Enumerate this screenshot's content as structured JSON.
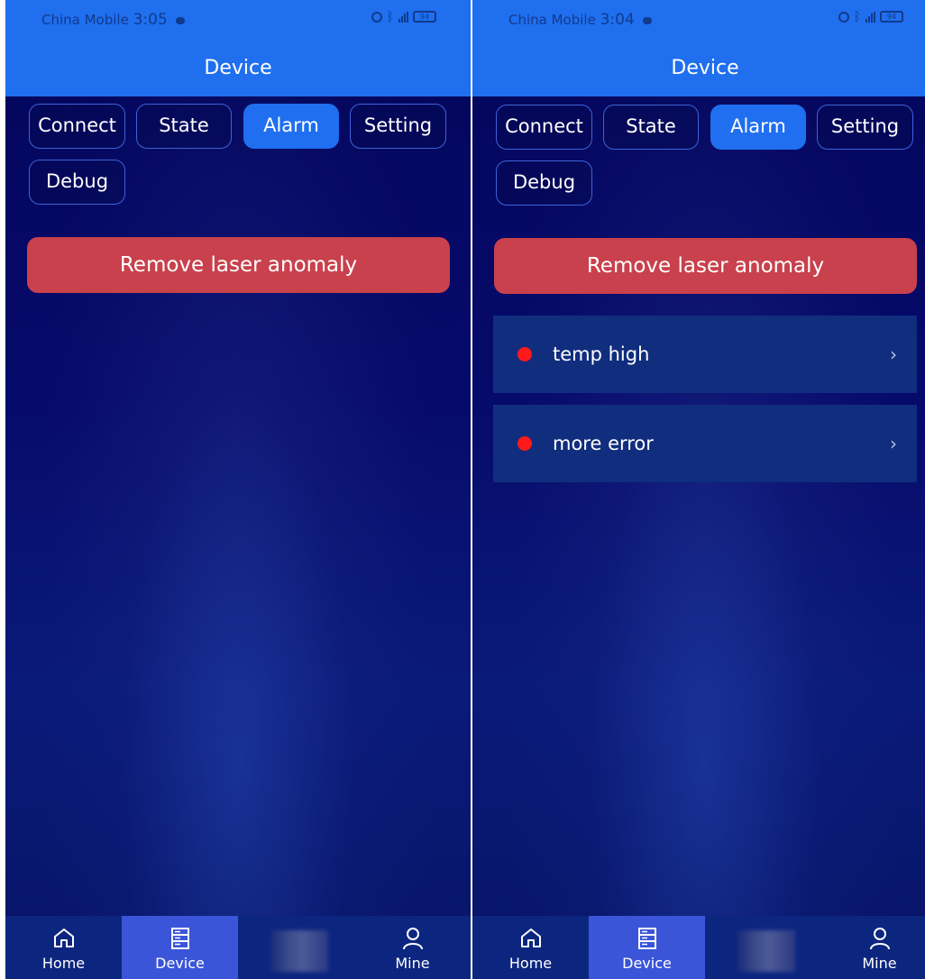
{
  "screens": [
    {
      "status": {
        "carrier": "China Mobile",
        "time": "3:05",
        "battery": "94"
      },
      "title": "Device",
      "tabs": [
        "Connect",
        "State",
        "Alarm",
        "Setting",
        "Debug"
      ],
      "active_tab": "Alarm",
      "remove_button": "Remove laser anomaly",
      "alarms": [],
      "nav": [
        "Home",
        "Device",
        "",
        "Mine"
      ],
      "active_nav": "Device"
    },
    {
      "status": {
        "carrier": "China Mobile",
        "time": "3:04",
        "battery": "94"
      },
      "title": "Device",
      "tabs": [
        "Connect",
        "State",
        "Alarm",
        "Setting",
        "Debug"
      ],
      "active_tab": "Alarm",
      "remove_button": "Remove laser anomaly",
      "alarms": [
        {
          "label": "temp high",
          "chevron": "›"
        },
        {
          "label": "more error",
          "chevron": "›"
        }
      ],
      "nav": [
        "Home",
        "Device",
        "",
        "Mine"
      ],
      "active_nav": "Device"
    }
  ],
  "colors": {
    "header": "#1f6fef",
    "active_tab": "#1f6ff0",
    "remove_button": "#c8414c",
    "alarm_dot": "#ff1a1a",
    "nav_active": "#3a55d8"
  },
  "icons": {
    "home": "home-icon",
    "device": "device-icon",
    "mine": "user-icon"
  }
}
